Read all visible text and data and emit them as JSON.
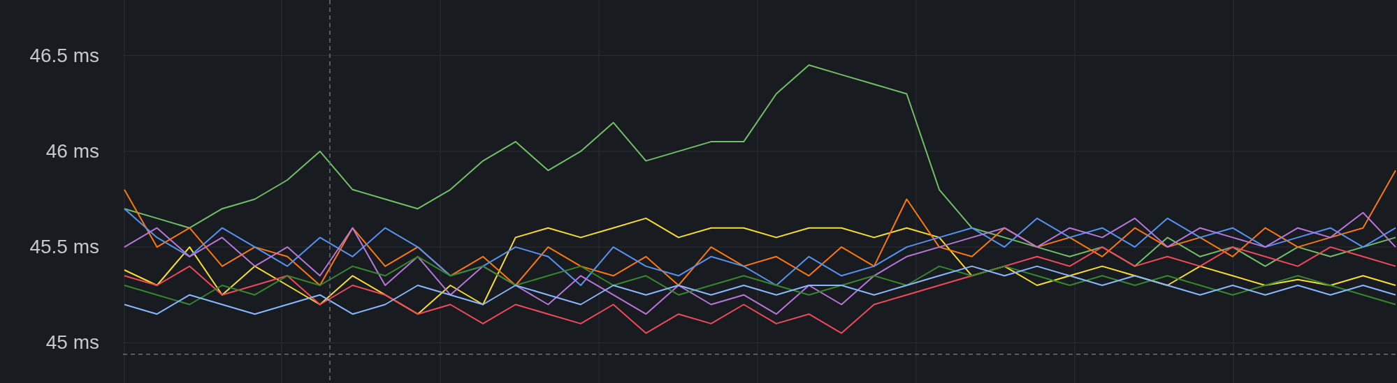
{
  "chart_data": {
    "type": "line",
    "grid": true,
    "ylim": [
      44.79,
      46.79
    ],
    "ref_lines": [
      {
        "axis": "y",
        "value": 44.94
      }
    ],
    "yticks": [
      {
        "value": 45,
        "label": "45 ms"
      },
      {
        "value": 45.5,
        "label": "45.5 ms"
      },
      {
        "value": 46,
        "label": "46 ms"
      },
      {
        "value": 46.5,
        "label": "46.5 ms"
      }
    ],
    "series": [
      {
        "color": "#73bf69",
        "values": [
          45.7,
          45.65,
          45.6,
          45.7,
          45.75,
          45.85,
          46.0,
          45.8,
          45.75,
          45.7,
          45.8,
          45.95,
          46.05,
          45.9,
          46.0,
          46.15,
          45.95,
          46.0,
          46.05,
          46.05,
          46.3,
          46.45,
          46.4,
          46.35,
          46.3,
          45.8,
          45.6,
          45.55,
          45.5,
          45.45,
          45.5,
          45.4,
          45.55,
          45.45,
          45.5,
          45.4,
          45.5,
          45.45,
          45.5,
          45.55
        ]
      },
      {
        "color": "#fade2a",
        "values": [
          45.38,
          45.3,
          45.5,
          45.25,
          45.4,
          45.3,
          45.2,
          45.35,
          45.25,
          45.15,
          45.3,
          45.2,
          45.55,
          45.6,
          45.55,
          45.6,
          45.65,
          45.55,
          45.6,
          45.6,
          45.55,
          45.6,
          45.6,
          45.55,
          45.6,
          45.55,
          45.35,
          45.4,
          45.3,
          45.35,
          45.4,
          45.35,
          45.3,
          45.4,
          45.35,
          45.3,
          45.33,
          45.3,
          45.35,
          45.3
        ]
      },
      {
        "color": "#ff780a",
        "values": [
          45.8,
          45.5,
          45.6,
          45.4,
          45.5,
          45.45,
          45.3,
          45.6,
          45.4,
          45.5,
          45.35,
          45.45,
          45.3,
          45.5,
          45.4,
          45.35,
          45.45,
          45.3,
          45.5,
          45.4,
          45.45,
          45.35,
          45.5,
          45.4,
          45.75,
          45.5,
          45.45,
          45.6,
          45.5,
          45.55,
          45.45,
          45.6,
          45.5,
          45.55,
          45.45,
          45.6,
          45.5,
          45.55,
          45.6,
          45.9
        ]
      },
      {
        "color": "#5794f2",
        "values": [
          45.7,
          45.55,
          45.45,
          45.6,
          45.5,
          45.4,
          45.55,
          45.45,
          45.6,
          45.5,
          45.35,
          45.4,
          45.5,
          45.45,
          45.3,
          45.5,
          45.4,
          45.35,
          45.45,
          45.4,
          45.3,
          45.45,
          45.35,
          45.4,
          45.5,
          45.55,
          45.6,
          45.5,
          45.65,
          45.55,
          45.6,
          45.5,
          45.65,
          45.55,
          45.6,
          45.5,
          45.55,
          45.6,
          45.5,
          45.6
        ]
      },
      {
        "color": "#b877d9",
        "values": [
          45.5,
          45.6,
          45.45,
          45.55,
          45.4,
          45.5,
          45.35,
          45.6,
          45.3,
          45.45,
          45.25,
          45.4,
          45.3,
          45.2,
          45.35,
          45.25,
          45.15,
          45.3,
          45.2,
          45.25,
          45.15,
          45.3,
          45.2,
          45.35,
          45.45,
          45.5,
          45.55,
          45.6,
          45.5,
          45.6,
          45.55,
          45.65,
          45.5,
          45.6,
          45.55,
          45.5,
          45.6,
          45.55,
          45.68,
          45.5
        ]
      },
      {
        "color": "#f2495c",
        "values": [
          45.35,
          45.3,
          45.4,
          45.25,
          45.3,
          45.35,
          45.2,
          45.3,
          45.25,
          45.15,
          45.2,
          45.1,
          45.2,
          45.15,
          45.1,
          45.2,
          45.05,
          45.15,
          45.1,
          45.2,
          45.1,
          45.15,
          45.05,
          45.2,
          45.25,
          45.3,
          45.35,
          45.4,
          45.45,
          45.4,
          45.5,
          45.4,
          45.45,
          45.4,
          45.5,
          45.45,
          45.4,
          45.5,
          45.45,
          45.4
        ]
      },
      {
        "color": "#37872d",
        "values": [
          45.3,
          45.25,
          45.2,
          45.3,
          45.25,
          45.35,
          45.3,
          45.4,
          45.35,
          45.45,
          45.35,
          45.4,
          45.3,
          45.35,
          45.4,
          45.3,
          45.35,
          45.25,
          45.3,
          45.35,
          45.3,
          45.25,
          45.3,
          45.35,
          45.3,
          45.4,
          45.35,
          45.4,
          45.35,
          45.3,
          45.35,
          45.3,
          45.35,
          45.3,
          45.25,
          45.3,
          45.35,
          45.3,
          45.25,
          45.2
        ]
      },
      {
        "color": "#8ab8ff",
        "values": [
          45.2,
          45.15,
          45.25,
          45.2,
          45.15,
          45.2,
          45.25,
          45.15,
          45.2,
          45.3,
          45.25,
          45.2,
          45.3,
          45.25,
          45.2,
          45.3,
          45.25,
          45.3,
          45.25,
          45.3,
          45.25,
          45.3,
          45.3,
          45.25,
          45.3,
          45.35,
          45.4,
          45.35,
          45.4,
          45.35,
          45.3,
          45.35,
          45.3,
          45.25,
          45.3,
          45.25,
          45.3,
          45.25,
          45.3,
          45.25
        ]
      }
    ]
  }
}
